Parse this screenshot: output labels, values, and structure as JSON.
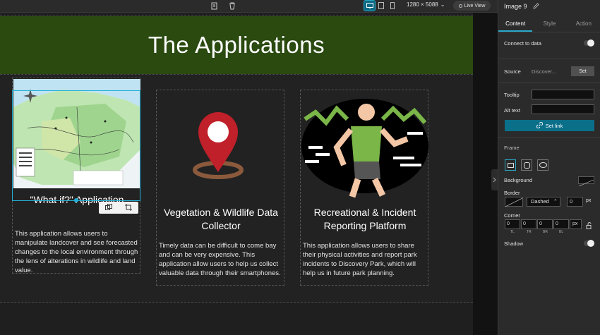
{
  "toolbar": {
    "resolution": "1280 × 5088",
    "live_view_label": "Live View"
  },
  "page": {
    "banner_title": "The Applications",
    "cards": [
      {
        "title": "\"What if?\" Application",
        "description": "This application allows users to manipulate landcover and see forecasted changes to the local environment through the lens of alterations in wildlife and land value."
      },
      {
        "title": "Vegetation & Wildlife Data Collector",
        "description": "Timely data can be difficult to come bay and can be very expensive. This application allow users to help us collect valuable data through their smartphones."
      },
      {
        "title": "Recreational & Incident Reporting Platform",
        "description": "This application allows users to share their physical activities and report park incidents to Discovery Park, which will help us in future park planning."
      }
    ]
  },
  "panel": {
    "title": "Image 9",
    "tabs": [
      "Content",
      "Style",
      "Action"
    ],
    "connect_to_data": "Connect to data",
    "source_label": "Source",
    "source_value": "Discover...",
    "set_label": "Set",
    "tooltip_label": "Tooltip",
    "alt_text_label": "Alt text",
    "set_link_label": "Set link",
    "frame_label": "Frame",
    "background_label": "Background",
    "border_label": "Border",
    "border_style": "Dashed",
    "border_width": "0",
    "border_unit": "px",
    "corner_label": "Corner",
    "corner_values": [
      "0",
      "0",
      "0",
      "0"
    ],
    "corner_sublabels": [
      "TL",
      "TR",
      "BR",
      "BL"
    ],
    "corner_unit": "px",
    "shadow_label": "Shadow"
  },
  "colors": {
    "banner": "#2a4a10",
    "accent": "#28a9c9",
    "pin_red": "#c0202a",
    "pin_brown": "#8b5a3c"
  }
}
